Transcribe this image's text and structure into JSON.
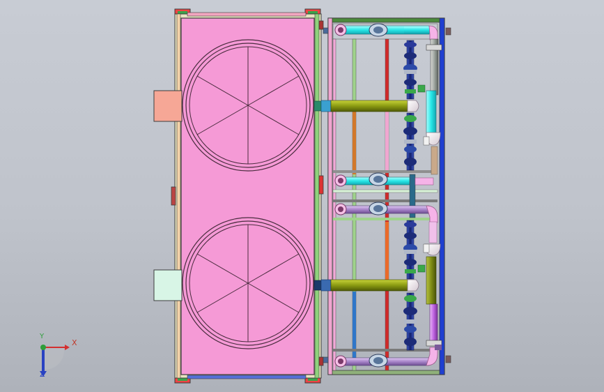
{
  "viewport": {
    "background_top": "#c8ccd4",
    "background_bottom": "#aeb2ba"
  },
  "triad": {
    "x_label": "X",
    "y_label": "Y",
    "z_label": "Z",
    "x_color": "#d42f2f",
    "y_color": "#2e9e3a",
    "z_color": "#2942c2"
  },
  "model": {
    "housing_color": "#f59ad6",
    "fan_guard_color": "#4a2c3e",
    "frame_outline_color": "#3c3c3c",
    "pipe_colors": {
      "cyan": "#27e6e6",
      "purple": "#a784c9",
      "olive": "#8a9a12",
      "green": "#6bbf3a",
      "pink": "#f5b3e8",
      "blue": "#1f3fd0",
      "orange": "#d2782a",
      "red": "#d02a2a"
    },
    "inlet_box_top_color": "#f6a796",
    "inlet_box_bottom_color": "#d8f5e6",
    "valve_color": "#1c2b78"
  }
}
